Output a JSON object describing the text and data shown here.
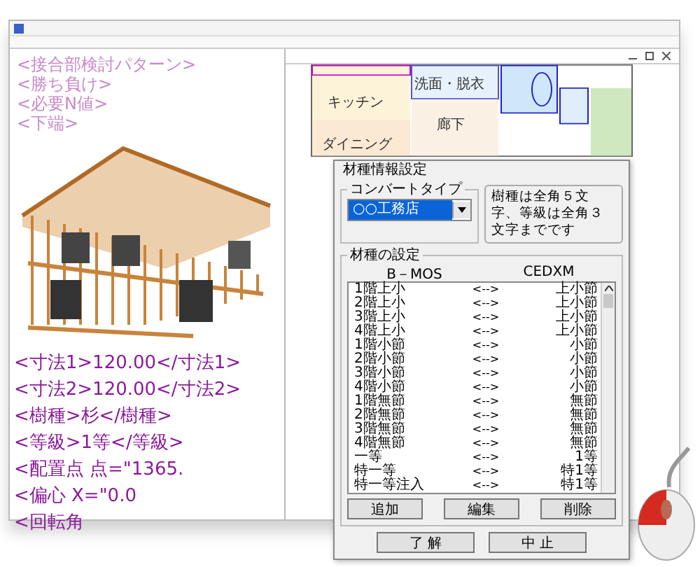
{
  "plan_labels": [
    "キッチン",
    "洗面・脱衣",
    "廊下",
    "ダイニング"
  ],
  "xml_overlay": [
    {
      "text": "<接合部検討パターン>",
      "kind": "faded"
    },
    {
      "text": "<勝ち負け>",
      "kind": "faded"
    },
    {
      "text": "<必要N値>",
      "kind": "faded"
    },
    {
      "text": "<下端>",
      "kind": "faded"
    },
    {
      "text": "<寸法1>120.00</寸法1>",
      "kind": "strong"
    },
    {
      "text": "<寸法2>120.00</寸法2>",
      "kind": "strong"
    },
    {
      "text": "<樹種>杉</樹種>",
      "kind": "strong"
    },
    {
      "text": "<等級>1等</等級>",
      "kind": "strong"
    },
    {
      "text": "<配置点 点=\"1365.",
      "kind": "strong"
    },
    {
      "text": "<偏心 X=\"0.0",
      "kind": "strong"
    },
    {
      "text": "<回転角",
      "kind": "strong"
    }
  ],
  "dialog": {
    "title": "材種情報設定",
    "convert_group": {
      "label": "コンバートタイプ",
      "value": "○○工務店"
    },
    "note": "樹種は全角５文字、等級は全角３文字までです",
    "mapping_group": {
      "label": "材種の設定",
      "columns": [
        "B－MOS",
        "CEDXM"
      ],
      "rows": [
        {
          "source": "1階上小",
          "arrow": "<-->",
          "target": "上小節"
        },
        {
          "source": "2階上小",
          "arrow": "<-->",
          "target": "上小節"
        },
        {
          "source": "3階上小",
          "arrow": "<-->",
          "target": "上小節"
        },
        {
          "source": "4階上小",
          "arrow": "<-->",
          "target": "上小節"
        },
        {
          "source": "1階小節",
          "arrow": "<-->",
          "target": "小節"
        },
        {
          "source": "2階小節",
          "arrow": "<-->",
          "target": "小節"
        },
        {
          "source": "3階小節",
          "arrow": "<-->",
          "target": "小節"
        },
        {
          "source": "4階小節",
          "arrow": "<-->",
          "target": "小節"
        },
        {
          "source": "1階無節",
          "arrow": "<-->",
          "target": "無節"
        },
        {
          "source": "2階無節",
          "arrow": "<-->",
          "target": "無節"
        },
        {
          "source": "3階無節",
          "arrow": "<-->",
          "target": "無節"
        },
        {
          "source": "4階無節",
          "arrow": "<-->",
          "target": "無節"
        },
        {
          "source": "一等",
          "arrow": "<-->",
          "target": "1等"
        },
        {
          "source": "特一等",
          "arrow": "<-->",
          "target": "特1等"
        },
        {
          "source": "特一等注入",
          "arrow": "<-->",
          "target": "特1等"
        }
      ]
    },
    "buttons": [
      "追加",
      "編集",
      "削除"
    ],
    "footer_buttons": [
      "了 解",
      "中 止"
    ]
  }
}
